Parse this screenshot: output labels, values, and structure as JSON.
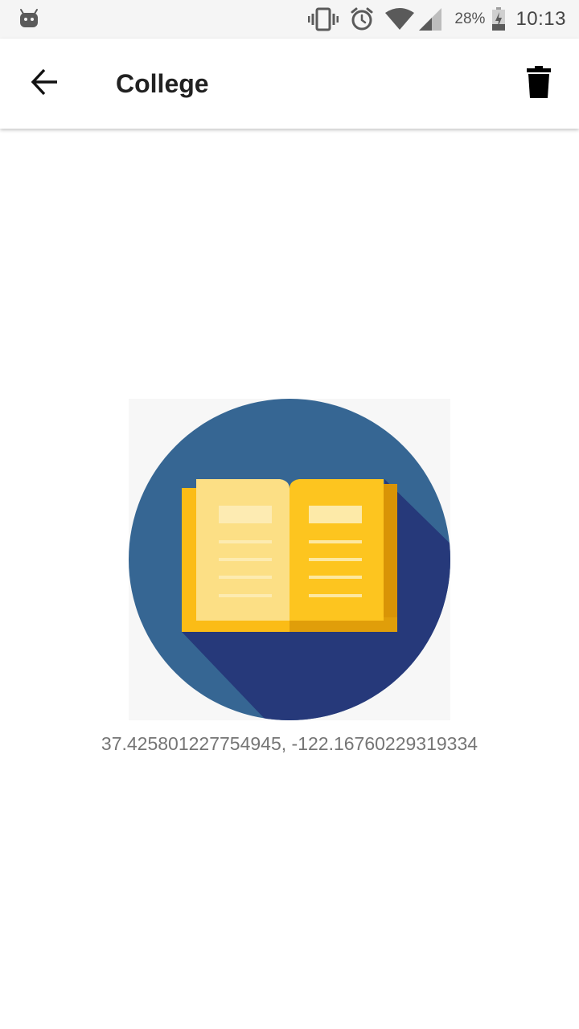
{
  "status_bar": {
    "notification_icon": "android-icon",
    "vibrate_icon": "vibrate-icon",
    "alarm_icon": "alarm-icon",
    "wifi_icon": "wifi-icon",
    "signal_icon": "cell-signal-icon",
    "battery_percent": "28%",
    "battery_icon": "battery-charging-icon",
    "time": "10:13"
  },
  "app_bar": {
    "back_icon": "arrow-back-icon",
    "title": "College",
    "delete_icon": "trash-icon"
  },
  "place": {
    "image_icon": "open-book-icon",
    "coordinates": "37.425801227754945, -122.16760229319334"
  },
  "colors": {
    "circle": "#366693",
    "shadow": "#26397a",
    "book_left": "#fcdf85",
    "book_right": "#fdc51f",
    "book_cover": "#fbbc16",
    "book_edge": "#d99406"
  }
}
